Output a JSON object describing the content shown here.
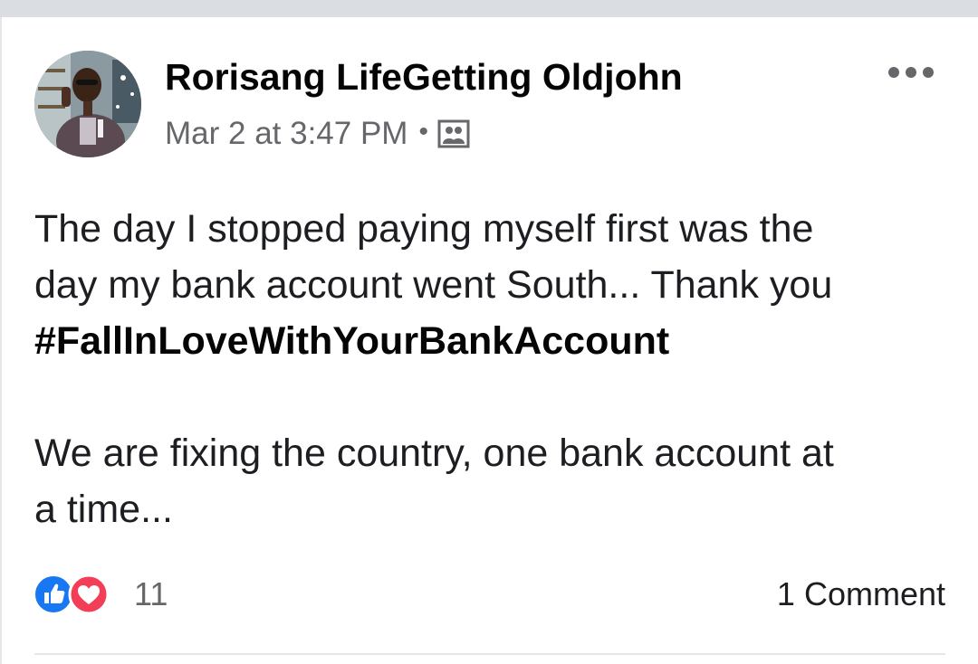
{
  "post": {
    "author": "Rorisang LifeGetting Oldjohn",
    "timestamp": "Mar 2 at 3:47 PM",
    "separator": "•",
    "audience_icon": "friends-icon",
    "more_icon": "more-options-icon",
    "body": {
      "line1": "The day I stopped paying myself first was the",
      "line2": "day my bank account went South... Thank you",
      "hashtag": "#FallInLoveWithYourBankAccount",
      "line4": "We are fixing the country, one bank account at",
      "line5": "a time..."
    },
    "reactions": {
      "types": [
        "like-icon",
        "love-icon"
      ],
      "count": "11",
      "like_color": "#1877f2",
      "love_color": "#f33e58"
    },
    "comments_label": "1 Comment"
  },
  "colors": {
    "top_band": "#dadde1",
    "secondary_text": "#65676b",
    "primary_text": "#050505"
  }
}
